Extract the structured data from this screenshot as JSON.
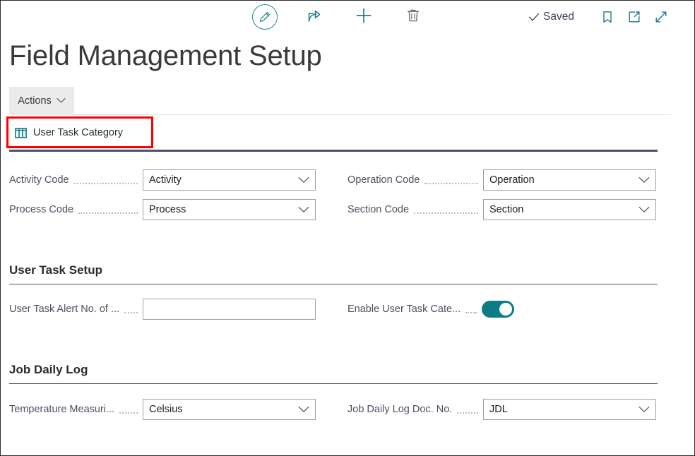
{
  "window": {
    "title": "Field Management Setup"
  },
  "commandbar": {
    "edit_icon": "pencil-icon",
    "share_icon": "share-icon",
    "new_icon": "plus-icon",
    "delete_icon": "trash-icon",
    "status_label": "Saved",
    "status_icon": "checkmark-icon",
    "bookmark_icon": "bookmark-icon",
    "popout_icon": "open-in-new-window-icon",
    "expand_icon": "expand-fullscreen-icon"
  },
  "tabbar": {
    "actions_label": "Actions",
    "actions_chevron": "chevron-down-icon"
  },
  "action_buttons": [
    {
      "label": "User Task Category",
      "icon": "table-grid-icon",
      "highlighted": true
    }
  ],
  "general": {
    "fields": [
      {
        "label": "Activity Code",
        "value": "Activity",
        "control": "dropdown",
        "column": "left"
      },
      {
        "label": "Process Code",
        "value": "Process",
        "control": "dropdown",
        "column": "left"
      },
      {
        "label": "Operation Code",
        "value": "Operation",
        "control": "dropdown",
        "column": "right"
      },
      {
        "label": "Section Code",
        "value": "Section",
        "control": "dropdown",
        "column": "right"
      }
    ]
  },
  "sections": [
    {
      "heading": "User Task Setup",
      "fields": [
        {
          "label": "User Task Alert No. of ...",
          "value": "",
          "placeholder": "",
          "control": "text",
          "column": "left"
        },
        {
          "label": "Enable User Task Cate...",
          "value": "on",
          "control": "toggle",
          "column": "right"
        }
      ]
    },
    {
      "heading": "Job Daily Log",
      "fields": [
        {
          "label": "Temperature Measuri...",
          "value": "Celsius",
          "control": "dropdown",
          "column": "left"
        },
        {
          "label": "Job Daily Log Doc. No.",
          "value": "JDL",
          "control": "dropdown",
          "column": "right"
        }
      ]
    }
  ],
  "colors": {
    "accent_teal": "#0e7c86",
    "rule_dark": "#4b5263",
    "highlight_red": "#ff0000",
    "label_gray": "#4a5160",
    "tab_bg": "#ebebeb"
  }
}
